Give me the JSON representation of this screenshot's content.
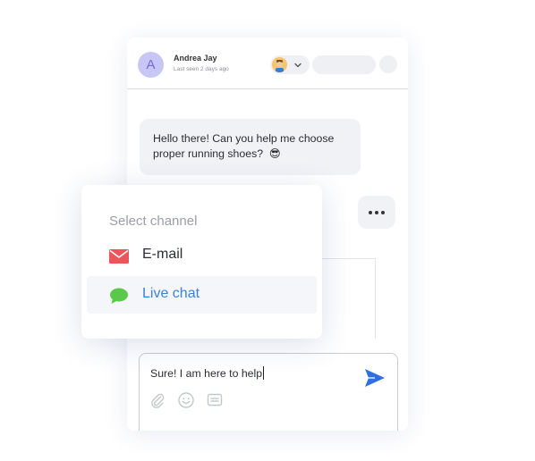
{
  "header": {
    "avatar_initial": "A",
    "contact_name": "Andrea Jay",
    "last_seen": "Last seen 2 days ago"
  },
  "messages": [
    {
      "direction": "incoming",
      "text_line1": "Hello there! Can you help me choose",
      "text_line2": "proper running shoes?",
      "emoji": "😎"
    }
  ],
  "typing_indicator": "•••",
  "composer": {
    "text": "Sure! I am here to help",
    "tools": [
      "paperclip-icon",
      "smiley-icon",
      "canned-responses-icon"
    ],
    "send_icon": "send-icon"
  },
  "channel_popup": {
    "heading": "Select channel",
    "options": [
      {
        "label": "E-mail",
        "icon": "envelope-icon",
        "color": "#f0545b",
        "selected": false
      },
      {
        "label": "Live chat",
        "icon": "chat-bubble-icon",
        "color": "#59c94a",
        "selected": true
      }
    ]
  },
  "colors": {
    "accent": "#3b82d6",
    "send": "#2f6fe0",
    "avatar_bg": "#c8c6f5"
  }
}
